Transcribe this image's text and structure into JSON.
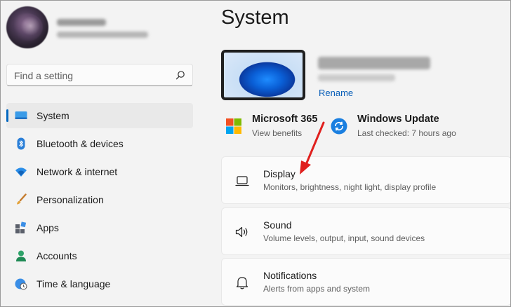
{
  "profile": {
    "name": "",
    "email": ""
  },
  "search": {
    "placeholder": "Find a setting",
    "icon": "search-icon"
  },
  "sidebar": {
    "items": [
      {
        "label": "System",
        "icon": "monitor-icon",
        "active": true
      },
      {
        "label": "Bluetooth & devices",
        "icon": "bluetooth-icon"
      },
      {
        "label": "Network & internet",
        "icon": "wifi-icon"
      },
      {
        "label": "Personalization",
        "icon": "brush-icon"
      },
      {
        "label": "Apps",
        "icon": "apps-icon"
      },
      {
        "label": "Accounts",
        "icon": "person-icon"
      },
      {
        "label": "Time & language",
        "icon": "globe-clock-icon"
      }
    ]
  },
  "main": {
    "title": "System",
    "device": {
      "rename_label": "Rename"
    },
    "quick_cards": [
      {
        "title": "Microsoft 365",
        "subtitle": "View benefits",
        "icon": "microsoft-logo-icon"
      },
      {
        "title": "Windows Update",
        "subtitle": "Last checked: 7 hours ago",
        "icon": "sync-icon"
      }
    ],
    "settings": [
      {
        "title": "Display",
        "subtitle": "Monitors, brightness, night light, display profile",
        "icon": "laptop-icon"
      },
      {
        "title": "Sound",
        "subtitle": "Volume levels, output, input, sound devices",
        "icon": "speaker-icon"
      },
      {
        "title": "Notifications",
        "subtitle": "Alerts from apps and system",
        "icon": "bell-icon"
      }
    ]
  },
  "colors": {
    "accent": "#0067c0",
    "annotation_arrow": "#e0201e",
    "background": "#f3f3f3",
    "card": "#fbfbfb"
  }
}
